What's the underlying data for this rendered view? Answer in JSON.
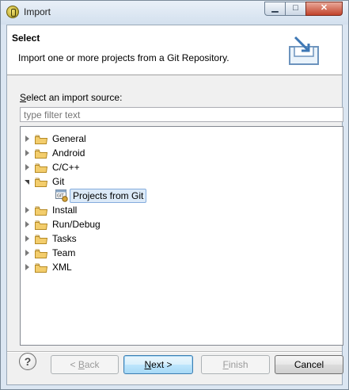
{
  "window": {
    "title": "Import",
    "min_glyph": "▁",
    "max_glyph": "□",
    "close_glyph": "✕"
  },
  "header": {
    "title": "Select",
    "description": "Import one or more projects from a Git Repository."
  },
  "source": {
    "label_prefix": "S",
    "label_rest": "elect an import source:",
    "filter_placeholder": "type filter text"
  },
  "tree": {
    "items": [
      {
        "label": "General",
        "expanded": false
      },
      {
        "label": "Android",
        "expanded": false
      },
      {
        "label": "C/C++",
        "expanded": false
      },
      {
        "label": "Git",
        "expanded": true
      },
      {
        "label": "Projects from Git",
        "child": true,
        "selected": true
      },
      {
        "label": "Install",
        "expanded": false
      },
      {
        "label": "Run/Debug",
        "expanded": false
      },
      {
        "label": "Tasks",
        "expanded": false
      },
      {
        "label": "Team",
        "expanded": false
      },
      {
        "label": "XML",
        "expanded": false
      }
    ]
  },
  "buttons": {
    "help": "?",
    "back_prefix": "< ",
    "back_mnemonic": "B",
    "back_rest": "ack",
    "next_prefix": "",
    "next_mnemonic": "N",
    "next_rest": "ext >",
    "finish_prefix": "",
    "finish_mnemonic": "F",
    "finish_rest": "inish",
    "cancel": "Cancel"
  },
  "colors": {
    "folder": "#e8b94a",
    "selection": "#dceaf8",
    "default_button": "#3c7fb1"
  }
}
